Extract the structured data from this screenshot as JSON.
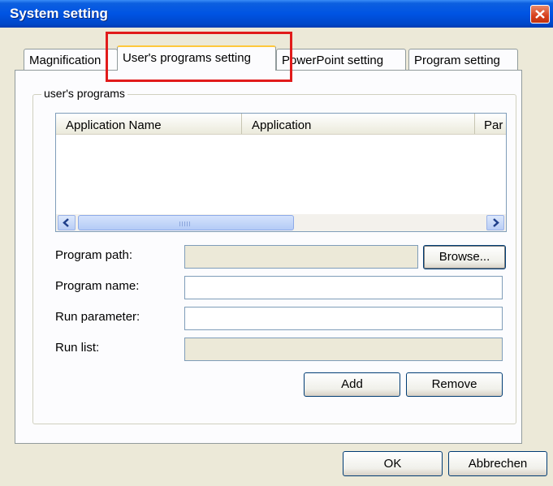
{
  "window": {
    "title": "System setting"
  },
  "tabs": [
    {
      "label": "Magnification"
    },
    {
      "label": "User's programs setting"
    },
    {
      "label": "PowerPoint setting"
    },
    {
      "label": "Program setting"
    }
  ],
  "group": {
    "label": "user's programs"
  },
  "list": {
    "columns": [
      "Application Name",
      "Application",
      "Par"
    ],
    "rows": []
  },
  "form": {
    "program_path": {
      "label": "Program path:",
      "value": ""
    },
    "program_name": {
      "label": "Program name:",
      "value": ""
    },
    "run_parameter": {
      "label": "Run parameter:",
      "value": ""
    },
    "run_list": {
      "label": "Run list:",
      "value": ""
    }
  },
  "buttons": {
    "browse": "Browse...",
    "add": "Add",
    "remove": "Remove",
    "ok": "OK",
    "cancel": "Abbrechen"
  },
  "colors": {
    "highlight": "#e11b1b",
    "titlebar": "#0054e3"
  }
}
